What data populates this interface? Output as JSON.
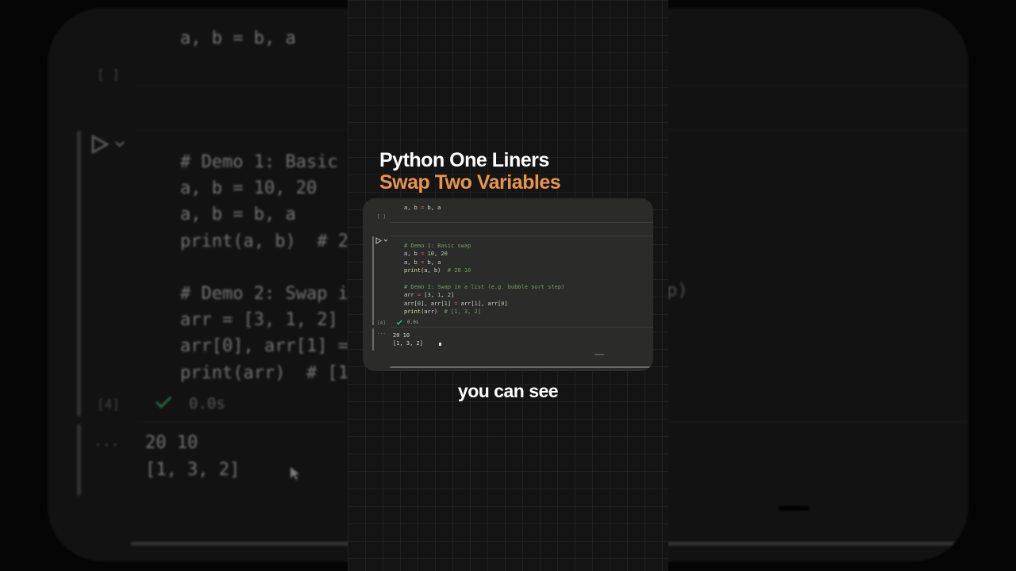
{
  "title": {
    "line1": "Python One Liners",
    "line2": "Swap Two Variables"
  },
  "subtitle": "you can see",
  "notebook": {
    "cell1": {
      "code": "a, b = b, a",
      "exec_label": "[ ]"
    },
    "cell2": {
      "exec_label": "[4]",
      "code_lines": [
        "# Demo 1: Basic swap",
        "a, b = 10, 20",
        "a, b = b, a",
        "print(a, b)  # 20 10",
        "",
        "# Demo 2: Swap in a list (e.g. bubble sort step)",
        "arr = [3, 1, 2]",
        "arr[0], arr[1] = arr[1], arr[0]",
        "print(arr)  # [1, 3, 2]"
      ],
      "status_icon": "check-icon",
      "exec_time": "0.0s",
      "output_menu": "...",
      "output_lines": [
        "20 10",
        "[1, 3, 2]"
      ]
    }
  },
  "background_view": {
    "cell1_code": "a, b = b, a",
    "cell1_label": "[ ]",
    "code_lines": [
      "# Demo 1: Basic",
      "a, b = 10, 20",
      "a, b = b, a",
      "print(a, b)  # 2",
      "",
      "# Demo 2: Swap i",
      "arr = [3, 1, 2]",
      "arr[0], arr[1] =",
      "print(arr)  # [1"
    ],
    "right_fragment": "p)",
    "exec_label": "[4]",
    "exec_time": "0.0s",
    "output_menu": "...",
    "output_lines": [
      "20 10",
      "[1, 3, 2]"
    ]
  },
  "colors": {
    "accent_orange": "#e8954a",
    "success_green": "#4ec98b",
    "comment_green": "#7a9a6c",
    "number": "#b5cea8",
    "operator": "#d16969",
    "function": "#dcdcaa"
  }
}
